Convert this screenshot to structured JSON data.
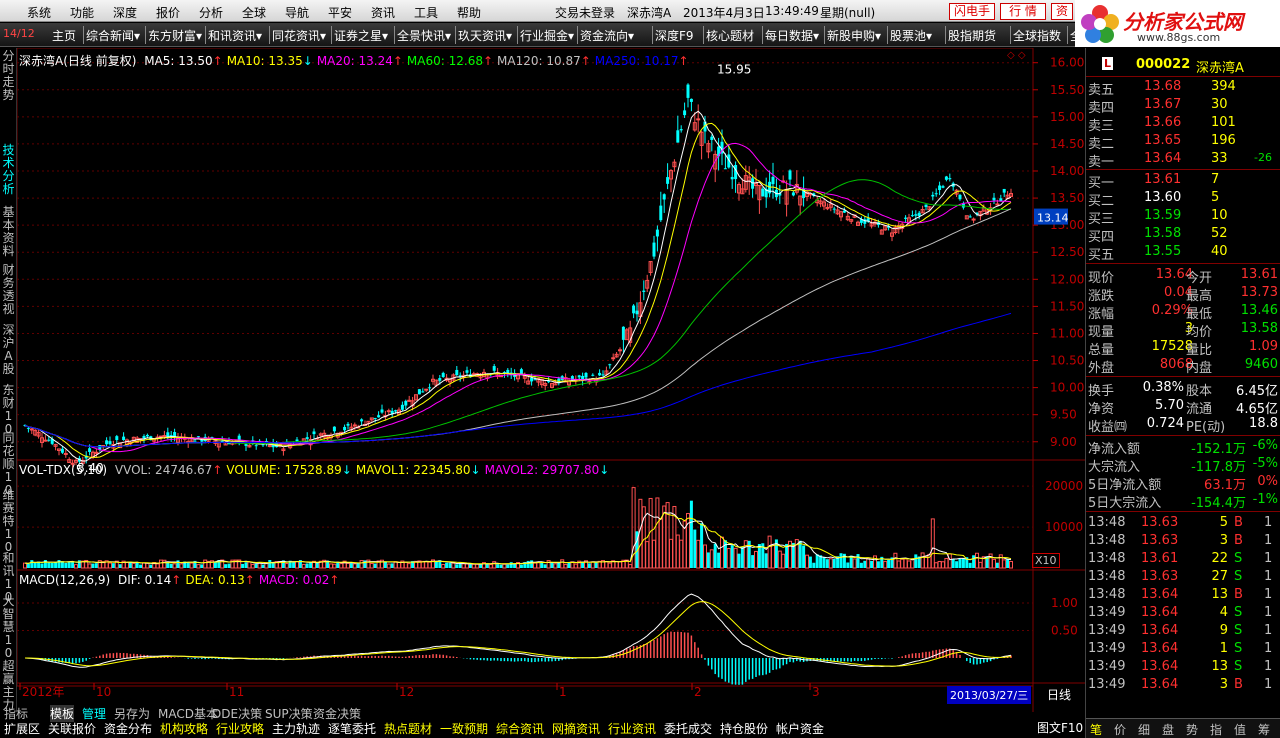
{
  "menu": {
    "items": [
      "系统",
      "功能",
      "深度",
      "报价",
      "分析",
      "全球",
      "导航",
      "平安",
      "资讯",
      "工具",
      "帮助"
    ],
    "login": "交易未登录",
    "stock": "深赤湾A",
    "date": "2013年4月3日",
    "time": "13:49:49",
    "weekday": "星期(null)",
    "btn_flash": "闪电手",
    "btn_quote": "行 情",
    "btn_zi": "资"
  },
  "logo": {
    "title": "分析家公式网",
    "url": "www.88gs.com"
  },
  "toolbar": {
    "page": "14/12",
    "items": [
      "主页",
      "综合新闻▾",
      "东方财富▾",
      "和讯资讯▾",
      "同花资讯▾",
      "证券之星▾",
      "全景快讯▾",
      "玖天资讯▾",
      "行业掘金▾",
      "资金流向▾",
      "深度F9",
      "核心题材",
      "每日数据▾",
      "新股申购▾",
      "股票池▾",
      "股指期货",
      "全球指数",
      "全"
    ]
  },
  "lefttabs": [
    "分时走势",
    "技术分析",
    "基本资料",
    "财务透视",
    "深沪A股",
    "东财10",
    "同花顺10",
    "维赛特10",
    "和讯10",
    "大智慧10",
    "超赢主力"
  ],
  "main": {
    "title": "深赤湾A(日线 前复权)",
    "ma": [
      {
        "label": "MA5: 13.50",
        "color": "#ffffff",
        "arrow": "↑"
      },
      {
        "label": "MA10: 13.35",
        "color": "#ffff00",
        "arrow": "↓"
      },
      {
        "label": "MA20: 13.24",
        "color": "#ff00ff",
        "arrow": "↑"
      },
      {
        "label": "MA60: 12.68",
        "color": "#00ff00",
        "arrow": "↑"
      },
      {
        "label": "MA120: 10.87",
        "color": "#c0c0c0",
        "arrow": "↑"
      },
      {
        "label": "MA250: 10.17",
        "color": "#0000ff",
        "arrow": "↑"
      }
    ],
    "high_label": "15.95",
    "low_label": "8.40",
    "price_tag": "13.14",
    "price_ticks": [
      "16.00",
      "15.50",
      "15.00",
      "14.50",
      "14.00",
      "13.50",
      "13.00",
      "12.50",
      "12.00",
      "11.50",
      "11.00",
      "10.50",
      "10.00",
      "9.50",
      "9.00"
    ]
  },
  "vol": {
    "title": "VOL-TDX(5,10)",
    "items": [
      {
        "label": "VVOL: 24746.67",
        "color": "#c0c0c0",
        "arrow": "↑"
      },
      {
        "label": "VOLUME: 17528.89",
        "color": "#ffff00",
        "arrow": "↓"
      },
      {
        "label": "MAVOL1: 22345.80",
        "color": "#ffff00",
        "arrow": "↓"
      },
      {
        "label": "MAVOL2: 29707.80",
        "color": "#ff00ff",
        "arrow": "↓"
      }
    ],
    "ticks": [
      "20000",
      "10000"
    ],
    "unit": "X10"
  },
  "macd": {
    "title": "MACD(12,26,9)",
    "items": [
      {
        "label": "DIF: 0.14",
        "color": "#ffffff",
        "arrow": "↑"
      },
      {
        "label": "DEA: 0.13",
        "color": "#ffff00",
        "arrow": "↑"
      },
      {
        "label": "MACD: 0.02",
        "color": "#ff00ff",
        "arrow": "↑"
      }
    ],
    "ticks": [
      "1.00",
      "0.50"
    ],
    "btn_text": "图文F10"
  },
  "dateaxis": {
    "labels": [
      "2012年",
      "10",
      "11",
      "12",
      "1",
      "2",
      "3"
    ],
    "current": "2013/03/27/三",
    "period": "日线"
  },
  "bottom": {
    "row1": [
      "指标",
      "模板",
      "管理",
      "另存为",
      "MACD基本",
      "DDE决策",
      "SUP决策",
      "资金决策"
    ],
    "row2": [
      {
        "t": "扩展区",
        "c": "#ffffff"
      },
      {
        "t": "关联报价",
        "c": "#ffffff"
      },
      {
        "t": "资金分布",
        "c": "#ffffff"
      },
      {
        "t": "机构攻略",
        "c": "#ffff00"
      },
      {
        "t": "行业攻略",
        "c": "#ffff00"
      },
      {
        "t": "主力轨迹",
        "c": "#ffffff"
      },
      {
        "t": "逐笔委托",
        "c": "#ffffff"
      },
      {
        "t": "热点题材",
        "c": "#ffff00"
      },
      {
        "t": "一致预期",
        "c": "#ffff00"
      },
      {
        "t": "综合资讯",
        "c": "#ffff00"
      },
      {
        "t": "网摘资讯",
        "c": "#ffff00"
      },
      {
        "t": "行业资讯",
        "c": "#ffff00"
      },
      {
        "t": "委托成交",
        "c": "#ffffff"
      },
      {
        "t": "持仓股份",
        "c": "#ffffff"
      },
      {
        "t": "帐户资金",
        "c": "#ffffff"
      }
    ]
  },
  "quote": {
    "code": "000022",
    "name": "深赤湾A",
    "sell": [
      {
        "l": "卖五",
        "p": "13.68",
        "v": "394",
        "d": ""
      },
      {
        "l": "卖四",
        "p": "13.67",
        "v": "30",
        "d": ""
      },
      {
        "l": "卖三",
        "p": "13.66",
        "v": "101",
        "d": ""
      },
      {
        "l": "卖二",
        "p": "13.65",
        "v": "196",
        "d": ""
      },
      {
        "l": "卖一",
        "p": "13.64",
        "v": "33",
        "d": "-26"
      }
    ],
    "buy": [
      {
        "l": "买一",
        "p": "13.61",
        "v": "7",
        "pc": "#ff3030"
      },
      {
        "l": "买二",
        "p": "13.60",
        "v": "5",
        "pc": "#ffffff"
      },
      {
        "l": "买三",
        "p": "13.59",
        "v": "10",
        "pc": "#00e000"
      },
      {
        "l": "买四",
        "p": "13.58",
        "v": "52",
        "pc": "#00e000"
      },
      {
        "l": "买五",
        "p": "13.55",
        "v": "40",
        "pc": "#00e000"
      }
    ],
    "stats": [
      {
        "a": "现价",
        "av": "13.64",
        "ac": "#ff3030",
        "b": "今开",
        "bv": "13.61",
        "bc": "#ff3030"
      },
      {
        "a": "涨跌",
        "av": "0.04",
        "ac": "#ff3030",
        "b": "最高",
        "bv": "13.73",
        "bc": "#ff3030"
      },
      {
        "a": "涨幅",
        "av": "0.29%",
        "ac": "#ff3030",
        "b": "最低",
        "bv": "13.46",
        "bc": "#00e000"
      },
      {
        "a": "现量",
        "av": "3",
        "ac": "#ffff00",
        "b": "均价",
        "bv": "13.58",
        "bc": "#00e000"
      },
      {
        "a": "总量",
        "av": "17528",
        "ac": "#ffff00",
        "b": "量比",
        "bv": "1.09",
        "bc": "#ff3030"
      },
      {
        "a": "外盘",
        "av": "8068",
        "ac": "#ff3030",
        "b": "内盘",
        "bv": "9460",
        "bc": "#00e000"
      }
    ],
    "fin": [
      {
        "a": "换手",
        "av": "0.38%",
        "b": "股本",
        "bv": "6.45亿"
      },
      {
        "a": "净资",
        "av": "5.70",
        "b": "流通",
        "bv": "4.65亿"
      },
      {
        "a": "收益㈣",
        "av": "0.724",
        "b": "PE(动)",
        "bv": "18.8"
      }
    ],
    "flow": [
      {
        "a": "净流入额",
        "v": "-152.1万",
        "p": "-6%",
        "c": "#00e000"
      },
      {
        "a": "大宗流入",
        "v": "-117.8万",
        "p": "-5%",
        "c": "#00e000"
      },
      {
        "a": "5日净流入额",
        "v": "63.1万",
        "p": "0%",
        "c": "#ff3030"
      },
      {
        "a": "5日大宗流入",
        "v": "-154.4万",
        "p": "-1%",
        "c": "#00e000"
      }
    ],
    "ticks": [
      {
        "t": "13:48",
        "p": "13.63",
        "v": "5",
        "s": "B",
        "n": "1"
      },
      {
        "t": "13:48",
        "p": "13.63",
        "v": "3",
        "s": "B",
        "n": "1"
      },
      {
        "t": "13:48",
        "p": "13.61",
        "v": "22",
        "s": "S",
        "n": "1"
      },
      {
        "t": "13:48",
        "p": "13.63",
        "v": "27",
        "s": "S",
        "n": "1"
      },
      {
        "t": "13:48",
        "p": "13.64",
        "v": "13",
        "s": "B",
        "n": "1"
      },
      {
        "t": "13:49",
        "p": "13.64",
        "v": "4",
        "s": "S",
        "n": "1"
      },
      {
        "t": "13:49",
        "p": "13.64",
        "v": "9",
        "s": "S",
        "n": "1"
      },
      {
        "t": "13:49",
        "p": "13.64",
        "v": "1",
        "s": "S",
        "n": "1"
      },
      {
        "t": "13:49",
        "p": "13.64",
        "v": "13",
        "s": "S",
        "n": "1"
      },
      {
        "t": "13:49",
        "p": "13.64",
        "v": "3",
        "s": "B",
        "n": "1"
      }
    ],
    "tabs": [
      "笔",
      "价",
      "细",
      "盘",
      "势",
      "指",
      "值",
      "筹"
    ]
  },
  "chart_data": {
    "type": "candlestick",
    "symbol": "深赤湾A",
    "period": "日线",
    "ylim": [
      8.4,
      16.0
    ],
    "price_path": [
      [
        0,
        9.3
      ],
      [
        8,
        9.0
      ],
      [
        15,
        8.6
      ],
      [
        25,
        9.0
      ],
      [
        40,
        9.1
      ],
      [
        60,
        9.0
      ],
      [
        75,
        8.9
      ],
      [
        85,
        9.1
      ],
      [
        95,
        9.25
      ],
      [
        110,
        9.6
      ],
      [
        120,
        10.1
      ],
      [
        135,
        10.3
      ],
      [
        155,
        10.1
      ],
      [
        170,
        10.2
      ],
      [
        178,
        11.0
      ],
      [
        185,
        12.5
      ],
      [
        190,
        14.0
      ],
      [
        195,
        15.3
      ],
      [
        200,
        14.6
      ],
      [
        205,
        14.2
      ],
      [
        215,
        13.6
      ],
      [
        225,
        13.7
      ],
      [
        235,
        13.4
      ],
      [
        245,
        13.1
      ],
      [
        255,
        12.9
      ],
      [
        265,
        13.3
      ],
      [
        272,
        13.9
      ],
      [
        278,
        13.1
      ],
      [
        285,
        13.4
      ],
      [
        290,
        13.64
      ]
    ],
    "high": 15.95,
    "low": 8.4
  }
}
